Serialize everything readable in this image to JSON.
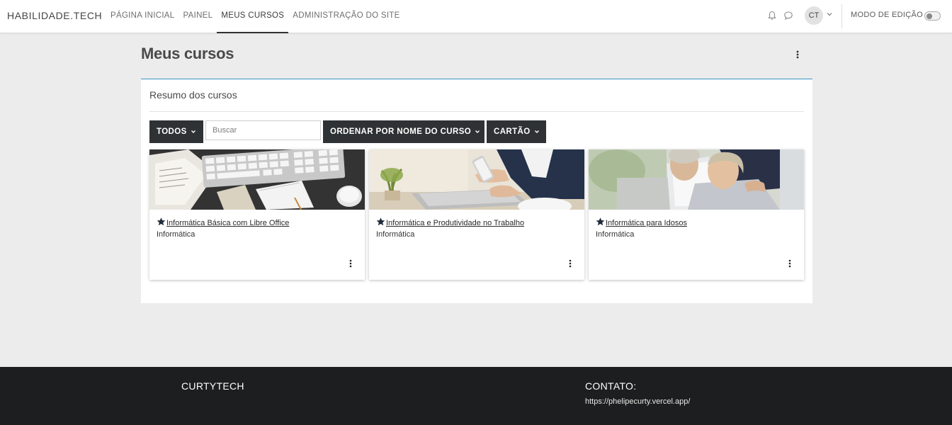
{
  "navbar": {
    "brand": "HABILIDADE.TECH",
    "links": [
      {
        "label": "PÁGINA INICIAL",
        "active": false
      },
      {
        "label": "PAINEL",
        "active": false
      },
      {
        "label": "MEUS CURSOS",
        "active": true
      },
      {
        "label": "ADMINISTRAÇÃO DO SITE",
        "active": false
      }
    ],
    "icons": [
      "bell-icon",
      "chat-icon",
      "chevron-down-icon"
    ],
    "avatar_initials": "CT",
    "edit_mode_label": "MODO DE EDIÇÃO",
    "edit_mode_on": false
  },
  "page": {
    "title": "Meus cursos"
  },
  "overview": {
    "title": "Resumo dos cursos",
    "filter_label": "TODOS",
    "search_placeholder": "Buscar",
    "sort_label": "ORDENAR POR NOME DO CURSO",
    "view_label": "CARTÃO"
  },
  "courses": [
    {
      "name": "Informática Básica com Libre Office",
      "category": "Informática",
      "starred": true,
      "image": "keyboard-desk-photo"
    },
    {
      "name": "Informática e Produtividade no Trabalho",
      "category": "Informática",
      "starred": true,
      "image": "laptop-phone-photo"
    },
    {
      "name": "Informática para Idosos",
      "category": "Informática",
      "starred": true,
      "image": "elderly-couple-photo"
    }
  ],
  "footer": {
    "brand": "CURTYTECH",
    "contact_title": "CONTATO:",
    "contact_url": "https://phelipecurty.vercel.app/"
  },
  "colors": {
    "navbar_bg": "#ffffff",
    "page_bg": "#ececec",
    "dark_button": "#2f3234",
    "card_accent": "#3a96c0",
    "footer_bg": "#1d1e1f"
  }
}
